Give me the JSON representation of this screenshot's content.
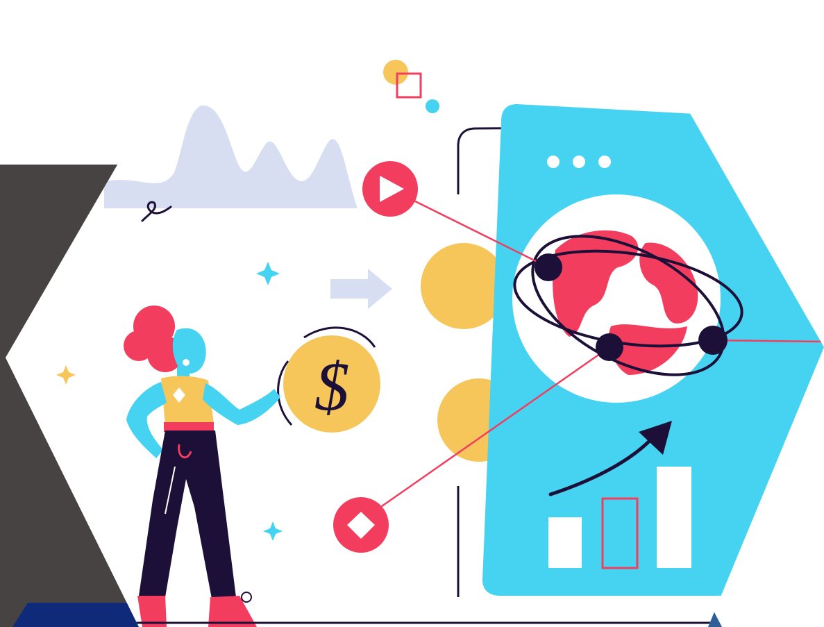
{
  "colors": {
    "background": "#ffffff",
    "dark_panel": "#474342",
    "navy_block": "#0e2a78",
    "steel_blue_block": "#2e5f99",
    "screen_cyan": "#45d3f1",
    "accent_red": "#f23d5e",
    "coin_yellow": "#f6c65b",
    "wave_lavender": "#d8def1",
    "outline_dark": "#1c1038"
  },
  "icons": [
    "play-icon",
    "diamond-icon",
    "dollar-coin-icon",
    "globe-icon",
    "bar-chart-icon",
    "trend-arrow-icon",
    "sparkle-icon",
    "right-arrow-icon"
  ],
  "illustration": {
    "subject": "woman-pointing-at-dollar-coin",
    "dollar_symbol": "$",
    "bar_levels": [
      0.45,
      0.62,
      0.92
    ],
    "highlighted_bar_index": 1
  }
}
